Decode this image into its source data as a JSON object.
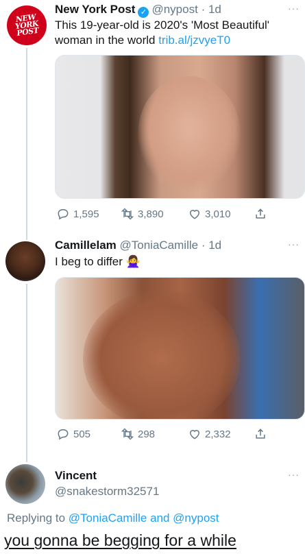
{
  "tweet1": {
    "avatar_text": "NEW YORK POST",
    "name": "New York Post",
    "handle": "@nypost",
    "separator": "·",
    "time": "1d",
    "text": "This 19-year-old is 2020's 'Most Beautiful' woman in the world ",
    "link": "trib.al/jzvyeT0",
    "stats": {
      "replies": "1,595",
      "retweets": "3,890",
      "likes": "3,010"
    }
  },
  "tweet2": {
    "name": "Camillelam",
    "handle": "@ToniaCamille",
    "separator": "·",
    "time": "1d",
    "text": "I beg to differ 🙅‍♀️",
    "stats": {
      "replies": "505",
      "retweets": "298",
      "likes": "2,332"
    }
  },
  "tweet3": {
    "name": "Vincent",
    "handle": "@snakestorm32571",
    "reply_prefix": "Replying to ",
    "reply_user1": "@ToniaCamille",
    "reply_and": " and ",
    "reply_user2": "@nypost"
  },
  "caption": "you gonna be begging for a while",
  "colors": {
    "link": "#1da1f2",
    "verified": "#1da1f2",
    "nyp_red": "#d0021b",
    "muted": "#657786"
  },
  "icons": [
    "verified-badge-icon",
    "reply-icon",
    "retweet-icon",
    "like-icon",
    "share-icon",
    "more-icon"
  ]
}
